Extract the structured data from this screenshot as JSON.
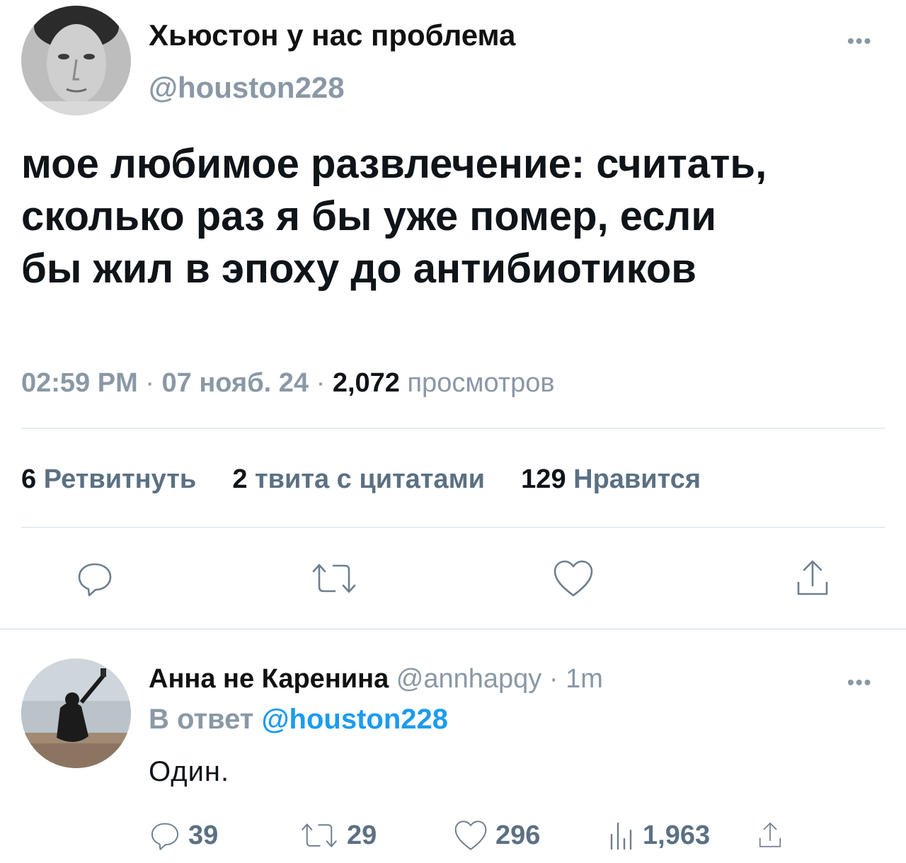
{
  "tweet": {
    "display_name": "Хьюстон у нас проблема",
    "handle": "@houston228",
    "more_icon": "ellipsis-icon",
    "text_lines": [
      "мое любимое развлечение: считать,",
      "сколько раз я бы уже помер, если",
      "бы жил в эпоху до антибиотиков"
    ],
    "time": "02:59 PM",
    "date": "07 нояб. 24",
    "views_count": "2,072",
    "views_label": "просмотров",
    "retweets_count": "6",
    "retweets_label": "Ретвитнуть",
    "quotes_count": "2",
    "quotes_label": "твита с цитатами",
    "likes_count": "129",
    "likes_label": "Нравится",
    "actions": [
      "reply-icon",
      "retweet-icon",
      "like-icon",
      "share-icon"
    ]
  },
  "reply": {
    "display_name": "Анна не Каренина",
    "handle": "@annhapqy",
    "time_ago": "1m",
    "reply_to_prefix": "В ответ",
    "reply_to_handle": "@houston228",
    "text": "Один.",
    "replies": "39",
    "retweets": "29",
    "likes": "296",
    "views": "1,963"
  },
  "separator": "·",
  "colors": {
    "accent": "#1d9bf0",
    "muted": "#8a98a6",
    "text": "#0f1419",
    "divider": "#e6ecf0"
  }
}
